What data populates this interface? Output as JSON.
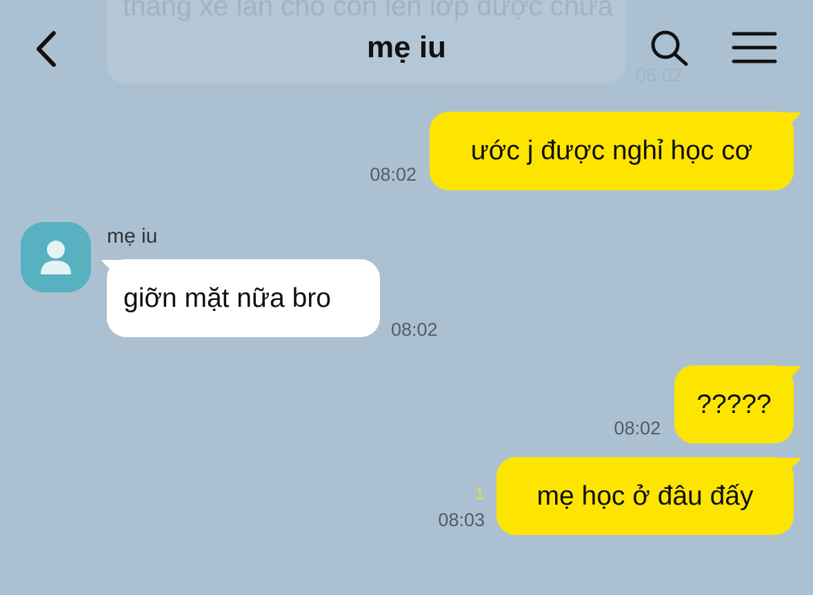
{
  "header": {
    "title": "mẹ iu"
  },
  "icons": {
    "back": "chevron-left-icon",
    "search": "search-icon",
    "menu": "hamburger-menu-icon"
  },
  "colors": {
    "background": "#abc1d2",
    "my_bubble": "#fde500",
    "their_bubble": "#ffffff",
    "avatar": "#57b1c0",
    "unread": "#f3dd2a"
  },
  "scrolled_message": {
    "text": "thằng xe lăn cho con lên lớp được chưa",
    "time": "08:02"
  },
  "messages": [
    {
      "sender": "me",
      "text": "ước j được nghỉ học cơ",
      "time": "08:02"
    },
    {
      "sender": "mẹ iu",
      "text": "giỡn mặt nữa bro",
      "time": "08:02"
    },
    {
      "sender": "me",
      "text": "?????",
      "time": "08:02"
    },
    {
      "sender": "me",
      "text": "mẹ học ở đâu đấy",
      "time": "08:03",
      "unread": "1"
    }
  ]
}
